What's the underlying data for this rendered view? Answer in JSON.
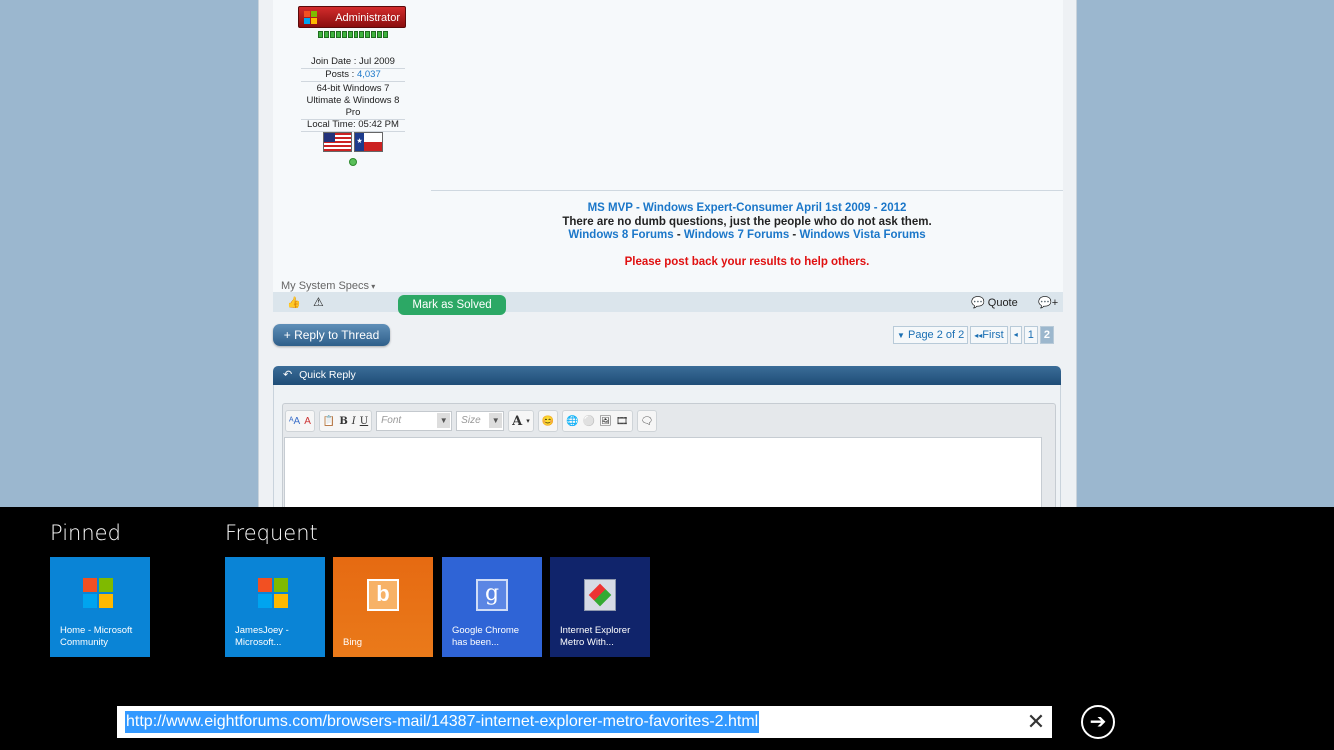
{
  "post": {
    "rank": "Administrator",
    "join_date": "Join Date : Jul 2009",
    "posts_label": "Posts : ",
    "posts_value": "4,037",
    "os_line": "64-bit Windows 7 Ultimate & Windows 8 Pro",
    "local_time": "Local Time: 05:42 PM",
    "signature": {
      "line1": "MS MVP - Windows Expert-Consumer April 1st 2009 - 2012",
      "line2": "There are no dumb questions, just the people who do not ask them.",
      "forum1": "Windows 8 Forums",
      "sep": " - ",
      "forum2": "Windows 7 Forums",
      "forum3": "Windows Vista Forums",
      "line4": "Please post back your results to help others."
    },
    "system_specs": "My System Specs",
    "mark_solved": "Mark as Solved",
    "quote": "Quote"
  },
  "thread": {
    "reply_button": "+ Reply to Thread",
    "pager": {
      "page_of": "Page 2 of 2",
      "first": "First",
      "pages": [
        "1",
        "2"
      ],
      "current": "2"
    },
    "quick_reply": "Quick Reply",
    "editor": {
      "font_placeholder": "Font",
      "size_placeholder": "Size"
    }
  },
  "appbar": {
    "pinned_label": "Pinned",
    "frequent_label": "Frequent",
    "pinned": [
      {
        "label": "Home - Microsoft Community",
        "color": "#0a84d6",
        "icon": "windows-logo"
      }
    ],
    "frequent": [
      {
        "label": "JamesJoey - Microsoft...",
        "color": "#0a84d6",
        "icon": "windows-logo"
      },
      {
        "label": "Bing",
        "color": "#e86c12",
        "icon": "bing-logo"
      },
      {
        "label": "Google Chrome has been...",
        "color": "#2f64d6",
        "icon": "google-logo"
      },
      {
        "label": "Internet Explorer Metro With...",
        "color": "#10246b",
        "icon": "site-icon"
      }
    ],
    "url": "http://www.eightforums.com/browsers-mail/14387-internet-explorer-metro-favorites-2.html"
  }
}
